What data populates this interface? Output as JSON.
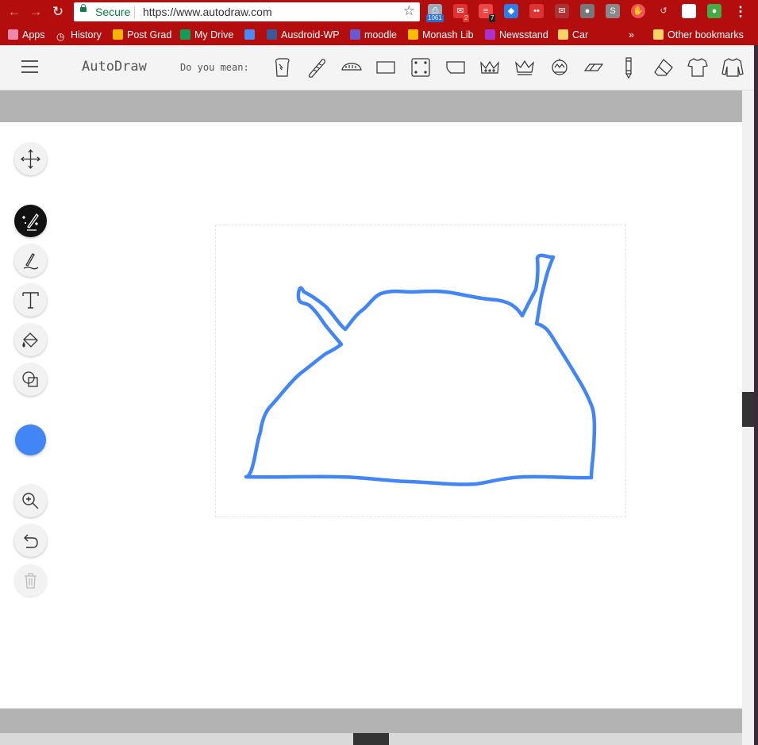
{
  "browser": {
    "secure_label": "Secure",
    "url": "https://www.autodraw.com",
    "ext_badges": [
      "1061",
      "2",
      "7"
    ],
    "bookmarks": [
      "Apps",
      "History",
      "Post Grad",
      "My Drive",
      "Ausdroid-WP",
      "moodle",
      "Monash Lib",
      "Newsstand",
      "Car"
    ],
    "overflow": "»",
    "other_bookmarks": "Other bookmarks"
  },
  "app": {
    "name": "AutoDraw",
    "suggest_label": "Do you mean:",
    "suggestions": [
      "toast",
      "baguette",
      "bread",
      "rectangle",
      "dice",
      "chip bag",
      "crown outline",
      "crown",
      "crown ornate",
      "eraser",
      "pencil",
      "eraser block",
      "t-shirt",
      "long-sleeve shirt"
    ]
  },
  "tools": [
    "select",
    "autodraw",
    "draw",
    "type",
    "fill",
    "shape",
    "color",
    "zoom",
    "undo",
    "delete"
  ],
  "colors": {
    "stroke": "#4285f4",
    "chrome": "#b30d0d",
    "header_bg": "#f4f4f4"
  }
}
